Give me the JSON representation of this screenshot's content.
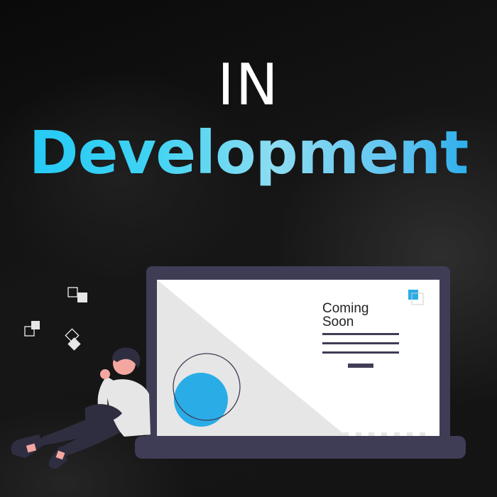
{
  "headline": {
    "line1": "IN",
    "line2": "Development"
  },
  "illustration": {
    "screen_text": "Coming Soon"
  },
  "colors": {
    "background": "#111111",
    "laptop_frame": "#3f3d56",
    "accent_blue": "#2aace7",
    "screen_white": "#ffffff",
    "screen_gray": "#e6e6e6"
  }
}
